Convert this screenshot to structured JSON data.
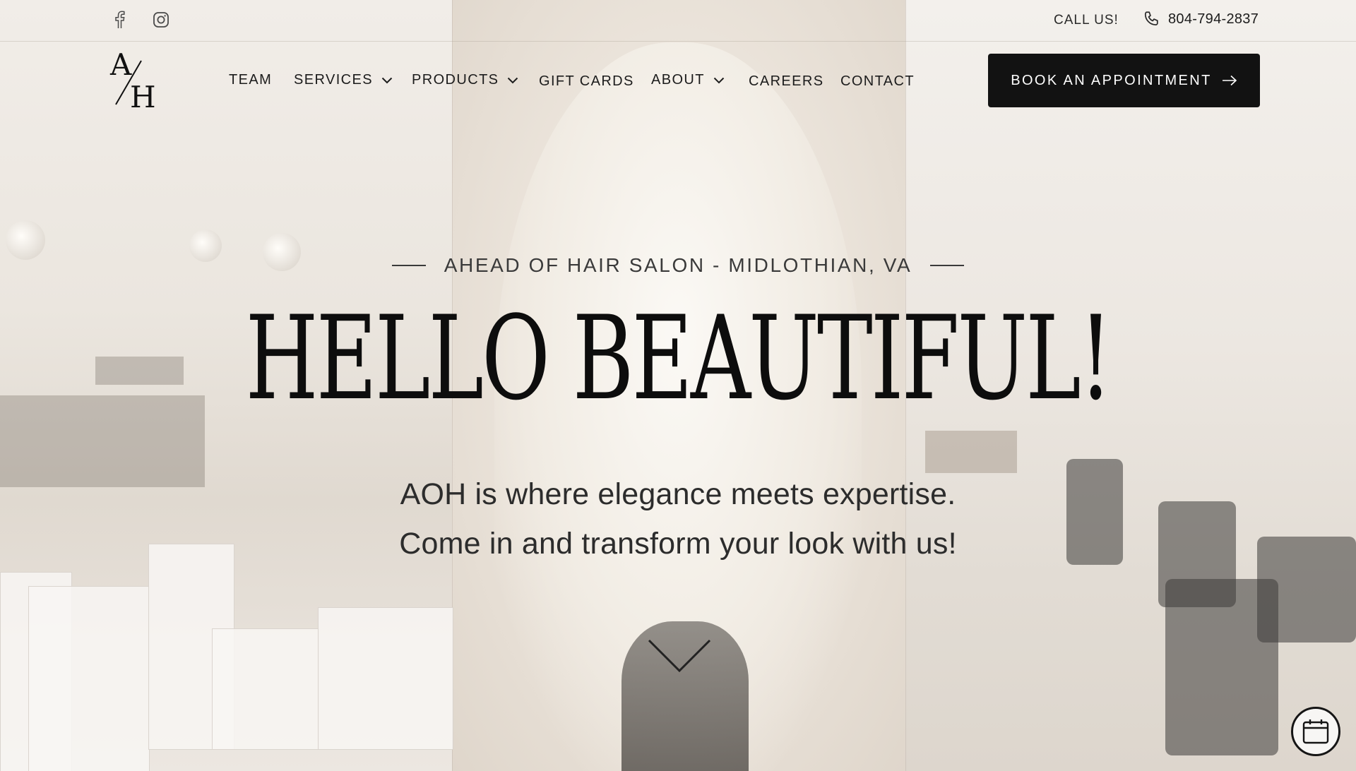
{
  "topbar": {
    "social": [
      {
        "icon": "facebook-icon"
      },
      {
        "icon": "instagram-icon"
      }
    ],
    "call_label": "CALL US!",
    "phone": "804-794-2837"
  },
  "nav": {
    "logo_icon": "ah-monogram-logo",
    "items": [
      {
        "label": "TEAM",
        "dropdown": false
      },
      {
        "label": "SERVICES",
        "dropdown": true
      },
      {
        "label": "PRODUCTS",
        "dropdown": true
      },
      {
        "label": "GIFT CARDS",
        "dropdown": false
      },
      {
        "label": "ABOUT",
        "dropdown": true
      },
      {
        "label": "CAREERS",
        "dropdown": false
      },
      {
        "label": "CONTACT",
        "dropdown": false
      }
    ],
    "cta": "BOOK AN APPOINTMENT"
  },
  "hero": {
    "eyebrow": "AHEAD OF HAIR SALON - MIDLOTHIAN, VA",
    "headline": "HELLO BEAUTIFUL!",
    "line1": "AOH is where elegance meets expertise.",
    "line2": "Come in and transform your look with us!",
    "scroll_icon": "chevron-down-icon"
  },
  "floating": {
    "icon": "calendar-icon"
  },
  "colors": {
    "button_bg": "#121212",
    "text_dark": "#0d0d0d",
    "background": "#ece6df"
  }
}
